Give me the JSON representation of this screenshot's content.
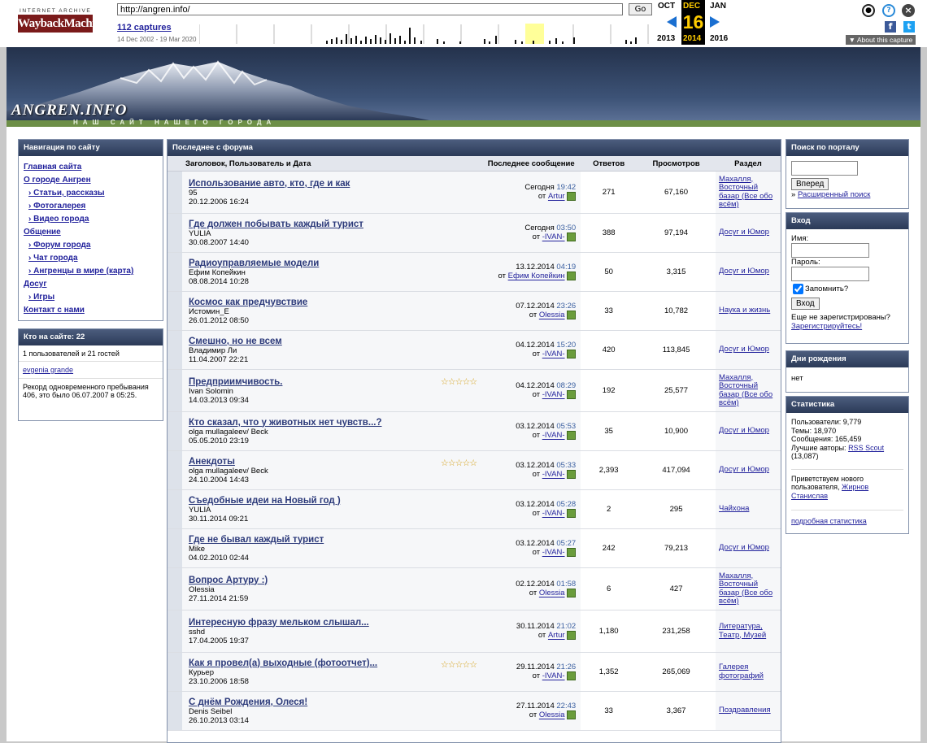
{
  "wayback": {
    "logo_top": "INTERNET ARCHIVE",
    "logo_main": "WaybackMachine",
    "url": "http://angren.info/",
    "go_label": "Go",
    "captures": "112 captures",
    "range": "14 Dec 2002 - 19 Mar 2020",
    "prev_month": "OCT",
    "cur_month": "DEC",
    "next_month": "JAN",
    "cur_day": "16",
    "prev_year": "2013",
    "cur_year": "2014",
    "next_year": "2016",
    "about": "About this capture"
  },
  "site": {
    "title": "ANGREN.INFO",
    "tagline": "НАШ САЙТ НАШЕГО ГОРОДА"
  },
  "nav": {
    "header": "Навигация по сайту",
    "items": [
      {
        "label": "Главная сайта",
        "sub": false
      },
      {
        "label": "О городе Ангрен",
        "sub": false
      },
      {
        "label": "› Статьи, рассказы",
        "sub": true
      },
      {
        "label": "› Фотогалерея",
        "sub": true
      },
      {
        "label": "› Видео города",
        "sub": true
      },
      {
        "label": "Общение",
        "sub": false
      },
      {
        "label": "› Форум города",
        "sub": true
      },
      {
        "label": "› Чат города",
        "sub": true
      },
      {
        "label": "› Ангренцы в мире (карта)",
        "sub": true
      },
      {
        "label": "Досуг",
        "sub": false
      },
      {
        "label": "› Игры",
        "sub": true
      },
      {
        "label": "Контакт с нами",
        "sub": false
      }
    ]
  },
  "online": {
    "header": "Кто на сайте: 22",
    "summary": "1 пользователей и 21 гостей",
    "user": "evgenia grande",
    "record": "Рекорд одновременного пребывания 406, это было 06.07.2007 в 05:25."
  },
  "forum": {
    "header": "Последнее с форума",
    "cols": {
      "title": "Заголовок, Пользователь и Дата",
      "last": "Последнее сообщение",
      "replies": "Ответов",
      "views": "Просмотров",
      "section": "Раздел"
    },
    "rows": [
      {
        "title": "Использование авто, кто, где и как",
        "user": "95",
        "date": "20.12.2006 16:24",
        "last_date": "Сегодня",
        "last_time": "19:42",
        "last_by": "Artur",
        "replies": "271",
        "views": "67,160",
        "section": "Махалля, Восточный базар (Все обо всём)",
        "stars": ""
      },
      {
        "title": "Где должен побывать каждый турист",
        "user": "YULIA",
        "date": "30.08.2007 14:40",
        "last_date": "Сегодня",
        "last_time": "03:50",
        "last_by": "-IVAN-",
        "replies": "388",
        "views": "97,194",
        "section": "Досуг и Юмор",
        "stars": ""
      },
      {
        "title": "Радиоуправляемые модели",
        "user": "Ефим Копейкин",
        "date": "08.08.2014 10:28",
        "last_date": "13.12.2014",
        "last_time": "04:19",
        "last_by": "Ефим Копейкин",
        "replies": "50",
        "views": "3,315",
        "section": "Досуг и Юмор",
        "stars": ""
      },
      {
        "title": "Космос как предчувствие",
        "user": "Истомин_Е",
        "date": "26.01.2012 08:50",
        "last_date": "07.12.2014",
        "last_time": "23:26",
        "last_by": "Olessia",
        "replies": "33",
        "views": "10,782",
        "section": "Наука и жизнь",
        "stars": ""
      },
      {
        "title": "Смешно, но не всем",
        "user": "Владимир Ли",
        "date": "11.04.2007 22:21",
        "last_date": "04.12.2014",
        "last_time": "15:20",
        "last_by": "-IVAN-",
        "replies": "420",
        "views": "113,845",
        "section": "Досуг и Юмор",
        "stars": ""
      },
      {
        "title": "Предприимчивость.",
        "user": "Ivan Solomin",
        "date": "14.03.2013 09:34",
        "last_date": "04.12.2014",
        "last_time": "08:29",
        "last_by": "-IVAN-",
        "replies": "192",
        "views": "25,577",
        "section": "Махалля, Восточный базар (Все обо всём)",
        "stars": "☆☆☆☆☆"
      },
      {
        "title": "Кто сказал, что у животных нет чувств...?",
        "user": "olga mullagaleev/ Beck",
        "date": "05.05.2010 23:19",
        "last_date": "03.12.2014",
        "last_time": "05:53",
        "last_by": "-IVAN-",
        "replies": "35",
        "views": "10,900",
        "section": "Досуг и Юмор",
        "stars": ""
      },
      {
        "title": "Анекдоты",
        "user": "olga mullagaleev/ Beck",
        "date": "24.10.2004 14:43",
        "last_date": "03.12.2014",
        "last_time": "05:33",
        "last_by": "-IVAN-",
        "replies": "2,393",
        "views": "417,094",
        "section": "Досуг и Юмор",
        "stars": "☆☆☆☆☆"
      },
      {
        "title": "Съедобные идеи на Новый год )",
        "user": "YULIA",
        "date": "30.11.2014 09:21",
        "last_date": "03.12.2014",
        "last_time": "05:28",
        "last_by": "-IVAN-",
        "replies": "2",
        "views": "295",
        "section": "Чайхона",
        "stars": ""
      },
      {
        "title": "Где не бывал каждый турист",
        "user": "Mike",
        "date": "04.02.2010 02:44",
        "last_date": "03.12.2014",
        "last_time": "05:27",
        "last_by": "-IVAN-",
        "replies": "242",
        "views": "79,213",
        "section": "Досуг и Юмор",
        "stars": ""
      },
      {
        "title": "Вопрос Артуру :)",
        "user": "Olessia",
        "date": "27.11.2014 21:59",
        "last_date": "02.12.2014",
        "last_time": "01:58",
        "last_by": "Olessia",
        "replies": "6",
        "views": "427",
        "section": "Махалля, Восточный базар (Все обо всём)",
        "stars": ""
      },
      {
        "title": "Интересную фразу мельком слышал...",
        "user": "sshd",
        "date": "17.04.2005 19:37",
        "last_date": "30.11.2014",
        "last_time": "21:02",
        "last_by": "Artur",
        "replies": "1,180",
        "views": "231,258",
        "section": "Литература, Театр, Музей",
        "stars": ""
      },
      {
        "title": "Как я провел(а) выходные (фотоотчет)...",
        "user": "Курьер",
        "date": "23.10.2006 18:58",
        "last_date": "29.11.2014",
        "last_time": "21:26",
        "last_by": "-IVAN-",
        "replies": "1,352",
        "views": "265,069",
        "section": "Галерея фотографий",
        "stars": "☆☆☆☆☆"
      },
      {
        "title": "С днём Рождения, Олеся!",
        "user": "Denis Seibel",
        "date": "26.10.2013 03:14",
        "last_date": "27.11.2014",
        "last_time": "22:43",
        "last_by": "Olessia",
        "replies": "33",
        "views": "3,367",
        "section": "Поздравления",
        "stars": ""
      }
    ]
  },
  "search": {
    "header": "Поиск по порталу",
    "button": "Вперед",
    "advanced": "Расширенный поиск"
  },
  "login": {
    "header": "Вход",
    "name_label": "Имя:",
    "pass_label": "Пароль:",
    "remember": "Запомнить?",
    "button": "Вход",
    "not_registered": "Еще не зарегистрированы?",
    "register": "Зарегистрируйтесь!"
  },
  "birthdays": {
    "header": "Дни рождения",
    "value": "нет"
  },
  "stats": {
    "header": "Статистика",
    "users": "Пользователи: 9,779",
    "topics": "Темы: 18,970",
    "posts": "Сообщения: 165,459",
    "best_label": "Лучшие авторы:",
    "best_user": "RSS Scout",
    "best_count": "(13,087)",
    "welcome": "Приветствуем нового пользователя,",
    "new_user": "Жирнов Станислав",
    "more": "подробная статистика"
  }
}
